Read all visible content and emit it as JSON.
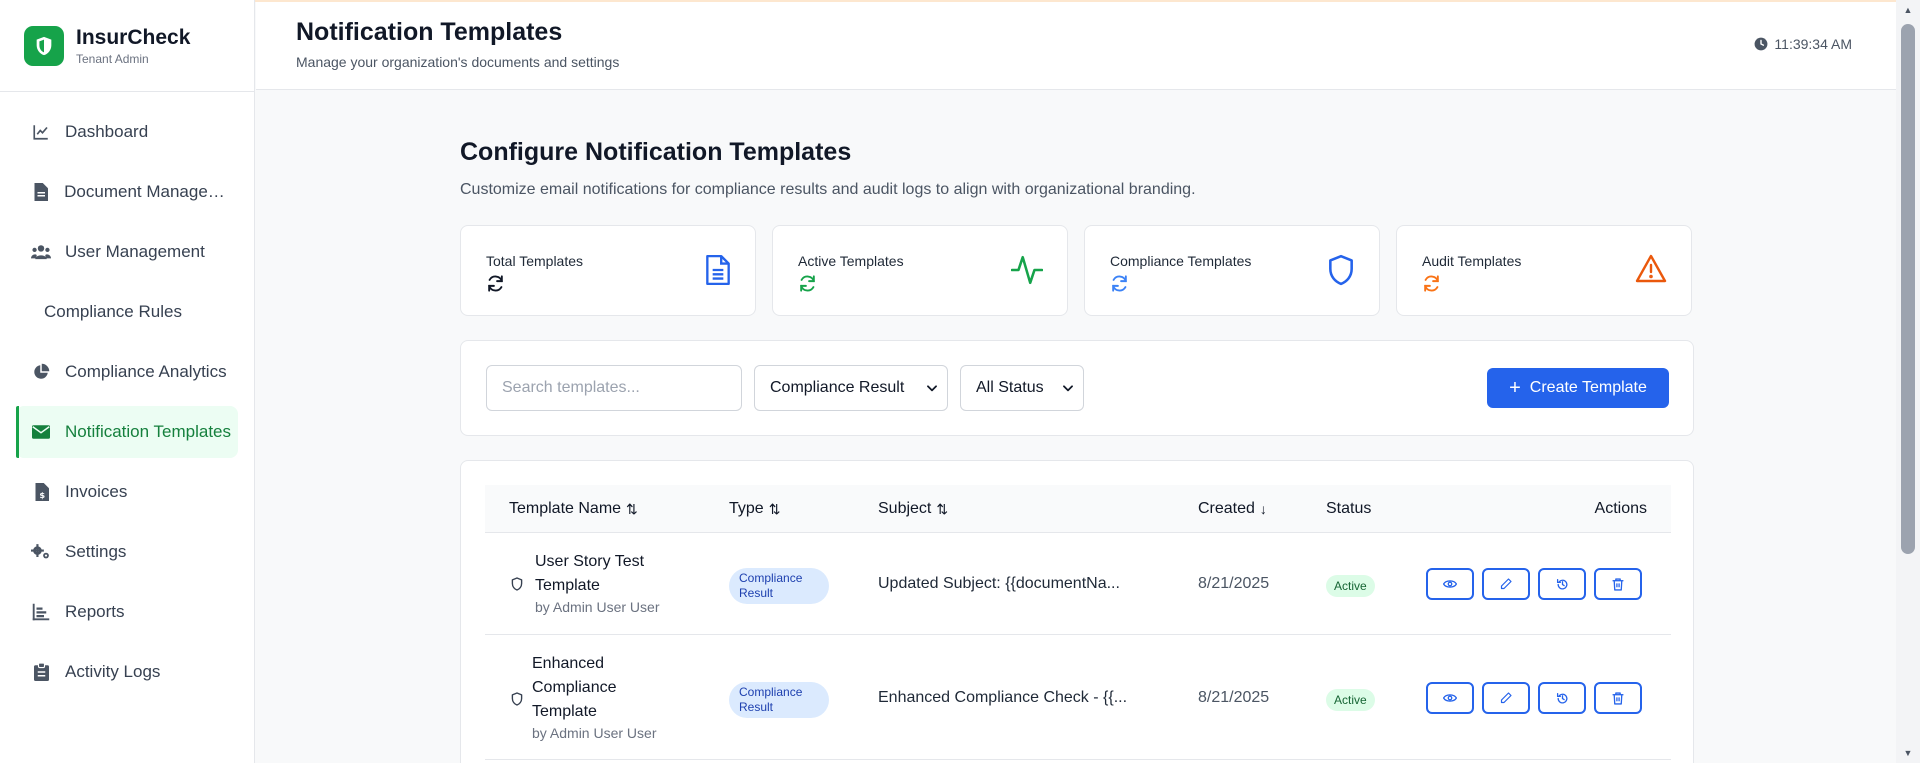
{
  "app": {
    "name": "InsurCheck",
    "role": "Tenant Admin"
  },
  "sidebar": {
    "items": [
      {
        "label": "Dashboard",
        "icon": "chart-line-icon",
        "active": false
      },
      {
        "label": "Document Management",
        "icon": "file-icon",
        "active": false
      },
      {
        "label": "User Management",
        "icon": "users-icon",
        "active": false
      },
      {
        "label": "Compliance Rules",
        "icon": "",
        "active": false
      },
      {
        "label": "Compliance Analytics",
        "icon": "pie-chart-icon",
        "active": false
      },
      {
        "label": "Notification Templates",
        "icon": "envelope-icon",
        "active": true
      },
      {
        "label": "Invoices",
        "icon": "invoice-icon",
        "active": false
      },
      {
        "label": "Settings",
        "icon": "cogs-icon",
        "active": false
      },
      {
        "label": "Reports",
        "icon": "bar-chart-icon",
        "active": false
      },
      {
        "label": "Activity Logs",
        "icon": "clipboard-icon",
        "active": false
      }
    ]
  },
  "header": {
    "title": "Notification Templates",
    "subtitle": "Manage your organization's documents and settings",
    "time": "11:39:34 AM"
  },
  "main": {
    "title": "Configure Notification Templates",
    "subtitle": "Customize email notifications for compliance results and audit logs to align with organizational branding.",
    "stats": [
      {
        "label": "Total Templates",
        "icon": "document-icon",
        "color": "#2563eb",
        "refresh_color": "#111827"
      },
      {
        "label": "Active Templates",
        "icon": "activity-icon",
        "color": "#16a34a",
        "refresh_color": "#16a34a"
      },
      {
        "label": "Compliance Templates",
        "icon": "shield-icon",
        "color": "#2563eb",
        "refresh_color": "#3b82f6"
      },
      {
        "label": "Audit Templates",
        "icon": "warning-icon",
        "color": "#ea580c",
        "refresh_color": "#f97316"
      }
    ],
    "filters": {
      "search_placeholder": "Search templates...",
      "type_value": "Compliance Result",
      "status_value": "All Status",
      "create_label": "Create Template"
    },
    "table": {
      "columns": {
        "name": "Template Name",
        "type": "Type",
        "subject": "Subject",
        "created": "Created",
        "status": "Status",
        "actions": "Actions"
      },
      "rows": [
        {
          "name_line1": "User Story Test",
          "name_line2": "Template",
          "name_line3": "",
          "author": "by Admin User User",
          "type_line1": "Compliance",
          "type_line2": "Result",
          "subject": "Updated Subject: {{documentNa...",
          "created": "8/21/2025",
          "status": "Active"
        },
        {
          "name_line1": "Enhanced",
          "name_line2": "Compliance",
          "name_line3": "Template",
          "author": "by Admin User User",
          "type_line1": "Compliance",
          "type_line2": "Result",
          "subject": "Enhanced Compliance Check - {{...",
          "created": "8/21/2025",
          "status": "Active"
        }
      ]
    }
  },
  "colors": {
    "brand": "#16a34a",
    "primary": "#2563eb"
  }
}
